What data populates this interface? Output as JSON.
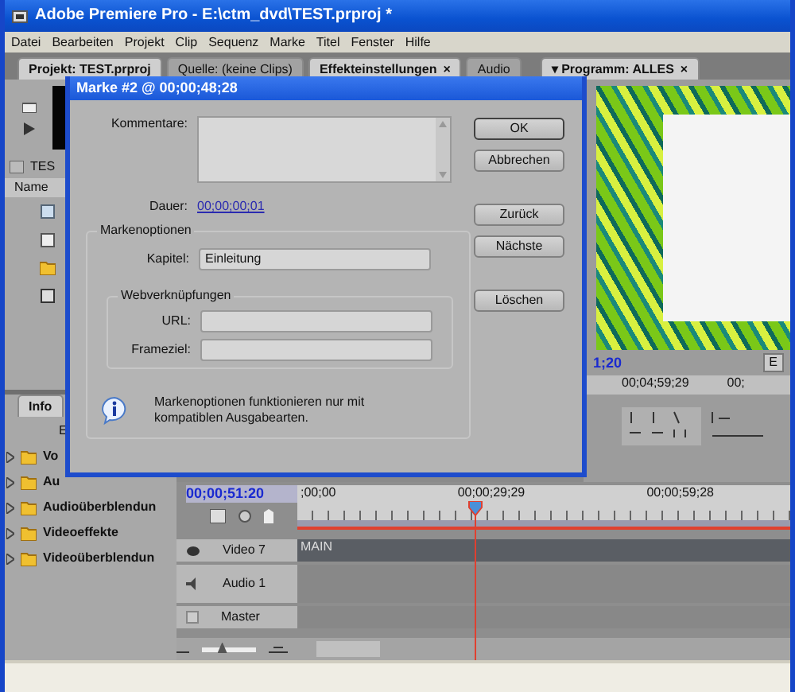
{
  "window": {
    "title": "Adobe Premiere Pro - E:\\ctm_dvd\\TEST.prproj *"
  },
  "menu": [
    "Datei",
    "Bearbeiten",
    "Projekt",
    "Clip",
    "Sequenz",
    "Marke",
    "Titel",
    "Fenster",
    "Hilfe"
  ],
  "tabs": [
    {
      "label": "Projekt: TEST.prproj",
      "selected": true
    },
    {
      "label": "Quelle: (keine Clips)",
      "selected": false
    },
    {
      "label": "Effekteinstellungen",
      "selected": true,
      "close": "×"
    },
    {
      "label": "Audio",
      "selected": false
    },
    {
      "label": "▾ Programm: ALLES",
      "selected": true,
      "close": "×"
    }
  ],
  "project_panel": {
    "clip_name": "TES",
    "column": "Name"
  },
  "info_panel": {
    "tab": "Info",
    "label": "E",
    "folders": [
      {
        "name": "Vo"
      },
      {
        "name": "Au"
      },
      {
        "name": "Audioüberblendun"
      },
      {
        "name": "Videoeffekte"
      },
      {
        "name": "Videoüberblendun"
      }
    ]
  },
  "program_monitor": {
    "timecode": "1;20",
    "button": "E",
    "ruler_labels": [
      "00;04;59;29",
      "00;"
    ]
  },
  "timeline": {
    "timecode": "00;00;51:20",
    "ruler_labels": [
      ";00;00",
      "00;00;29;29",
      "00;00;59;28"
    ],
    "tracks": [
      {
        "kind": "video",
        "name": "Video 7",
        "clip": "MAIN"
      },
      {
        "kind": "audio",
        "name": "Audio 1"
      },
      {
        "kind": "master",
        "name": "Master"
      }
    ],
    "zoom": {
      "level": 0.35
    }
  },
  "dialog": {
    "title": "Marke #2 @ 00;00;48;28",
    "comment_label": "Kommentare:",
    "duration_label": "Dauer:",
    "duration": "00;00;00;01",
    "options_group": "Markenoptionen",
    "chapter_label": "Kapitel:",
    "chapter": "Einleitung",
    "web_group": "Webverknüpfungen",
    "url_label": "URL:",
    "frame_label": "Frameziel:",
    "info": "Markenoptionen funktionieren nur mit kompatiblen Ausgabearten.",
    "buttons": [
      {
        "label": "OK",
        "default": true
      },
      {
        "label": "Abbrechen",
        "default": false
      },
      {
        "label": "Zurück",
        "default": false
      },
      {
        "label": "Nächste",
        "default": false
      },
      {
        "label": "Löschen",
        "default": false
      }
    ]
  }
}
